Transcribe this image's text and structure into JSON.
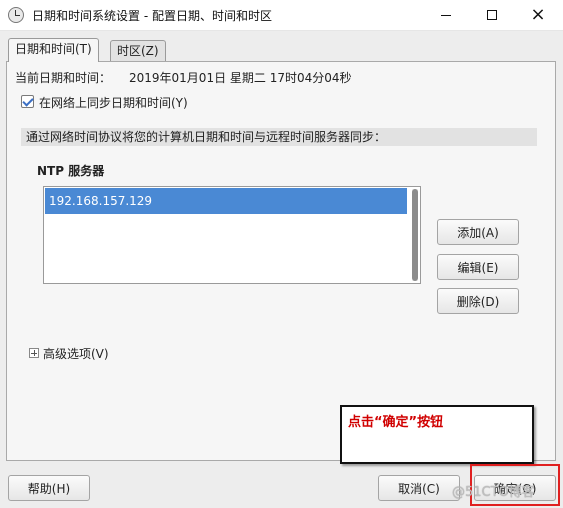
{
  "window": {
    "title": "日期和时间系统设置 - 配置日期、时间和时区",
    "app_icon": "clock-icon",
    "controls": {
      "minimize": "minimize-icon",
      "maximize": "maximize-icon",
      "close": "×"
    }
  },
  "tabs": [
    {
      "label": "日期和时间(T)",
      "active": true
    },
    {
      "label": "时区(Z)",
      "active": false
    }
  ],
  "current": {
    "label": "当前日期和时间：",
    "value": "2019年01月01日 星期二 17时04分04秒"
  },
  "sync": {
    "label": "在网络上同步日期和时间(Y)",
    "checked": true
  },
  "info": {
    "text": "通过网络时间协议将您的计算机日期和时间与远程时间服务器同步："
  },
  "ntp": {
    "heading": "NTP 服务器",
    "servers": [
      "192.168.157.129"
    ],
    "buttons": {
      "add": "添加(A)",
      "edit": "编辑(E)",
      "delete": "删除(D)"
    }
  },
  "advanced": {
    "label": "高级选项(V)",
    "expanded": false
  },
  "annotation": {
    "text": "点击“确定”按钮",
    "color": "#d00000"
  },
  "footer": {
    "help": "帮助(H)",
    "cancel": "取消(C)",
    "ok": "确定(O)"
  },
  "watermark": "@51CTO博客",
  "colors": {
    "selection": "#4a89d4",
    "highlight_box": "#e02020"
  }
}
